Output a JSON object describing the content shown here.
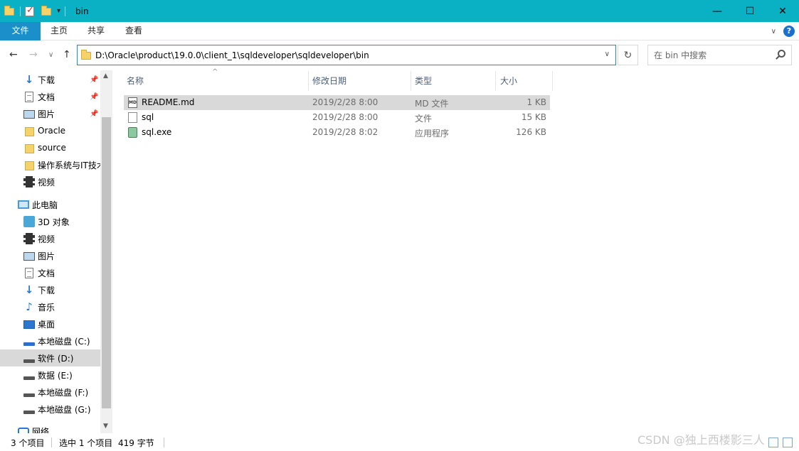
{
  "window": {
    "title": "bin",
    "minimize": "—",
    "maximize": "☐",
    "close": "✕"
  },
  "ribbon": {
    "tabs": [
      "文件",
      "主页",
      "共享",
      "查看"
    ],
    "help": "?"
  },
  "address": {
    "path": "D:\\Oracle\\product\\19.0.0\\client_1\\sqldeveloper\\sqldeveloper\\bin"
  },
  "search": {
    "placeholder": "在 bin 中搜索"
  },
  "sidebar": {
    "quick_access": [
      {
        "label": "下载",
        "icon": "download-icon",
        "pinned": true
      },
      {
        "label": "文档",
        "icon": "document-icon",
        "pinned": true
      },
      {
        "label": "图片",
        "icon": "picture-icon",
        "pinned": true
      },
      {
        "label": "Oracle",
        "icon": "folder-icon",
        "pinned": false
      },
      {
        "label": "source",
        "icon": "folder-icon",
        "pinned": false
      },
      {
        "label": "操作系统与IT技术",
        "icon": "folder-icon",
        "pinned": false
      },
      {
        "label": "视频",
        "icon": "video-icon",
        "pinned": false
      }
    ],
    "this_pc": {
      "label": "此电脑",
      "icon": "computer-icon"
    },
    "pc_items": [
      {
        "label": "3D 对象",
        "icon": "3d-objects-icon"
      },
      {
        "label": "视频",
        "icon": "video-icon"
      },
      {
        "label": "图片",
        "icon": "picture-icon"
      },
      {
        "label": "文档",
        "icon": "document-icon"
      },
      {
        "label": "下载",
        "icon": "download-icon"
      },
      {
        "label": "音乐",
        "icon": "music-icon"
      },
      {
        "label": "桌面",
        "icon": "desktop-icon"
      },
      {
        "label": "本地磁盘 (C:)",
        "icon": "system-drive-icon"
      },
      {
        "label": "软件 (D:)",
        "icon": "drive-icon",
        "selected": true
      },
      {
        "label": "数据 (E:)",
        "icon": "drive-icon"
      },
      {
        "label": "本地磁盘 (F:)",
        "icon": "drive-icon"
      },
      {
        "label": "本地磁盘 (G:)",
        "icon": "drive-icon"
      }
    ],
    "network": {
      "label": "网络",
      "icon": "network-icon"
    }
  },
  "columns": {
    "name": "名称",
    "date": "修改日期",
    "type": "类型",
    "size": "大小"
  },
  "files": [
    {
      "name": "README.md",
      "date": "2019/2/28 8:00",
      "type": "MD 文件",
      "size": "1 KB",
      "icon": "markdown-file-icon",
      "selected": true
    },
    {
      "name": "sql",
      "date": "2019/2/28 8:00",
      "type": "文件",
      "size": "15 KB",
      "icon": "file-icon",
      "selected": false
    },
    {
      "name": "sql.exe",
      "date": "2019/2/28 8:02",
      "type": "应用程序",
      "size": "126 KB",
      "icon": "executable-icon",
      "selected": false
    }
  ],
  "status": {
    "count": "3 个项目",
    "selection": "选中 1 个项目",
    "selection_size": "419 字节"
  },
  "watermark": "CSDN @独上西楼影三人"
}
